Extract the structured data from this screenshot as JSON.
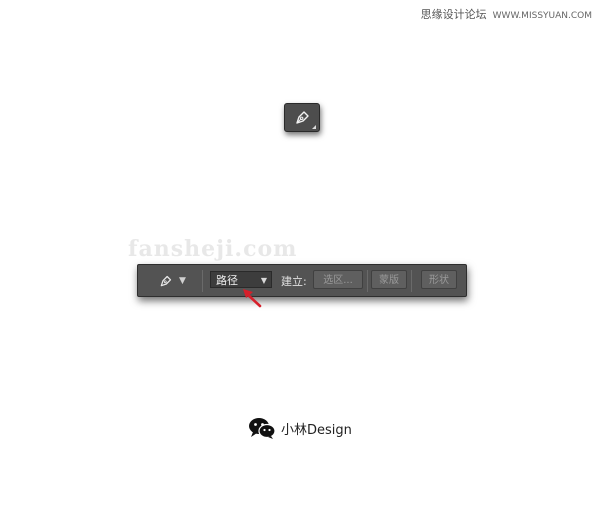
{
  "watermark": {
    "forum": "思缘设计论坛",
    "site": "WWW.MISSYUAN.COM",
    "middle": "fansheji.com"
  },
  "pen_tool": {
    "icon": "pen-tool-icon"
  },
  "options_bar": {
    "tool_icon": "pen-tool-icon",
    "mode_selected": "路径",
    "make_label": "建立:",
    "buttons": {
      "selection": "选区...",
      "mask": "蒙版",
      "shape": "形状"
    }
  },
  "annotation": {
    "arrow_color": "#d61f2a"
  },
  "footer": {
    "icon": "wechat-icon",
    "brand": "小林Design"
  }
}
